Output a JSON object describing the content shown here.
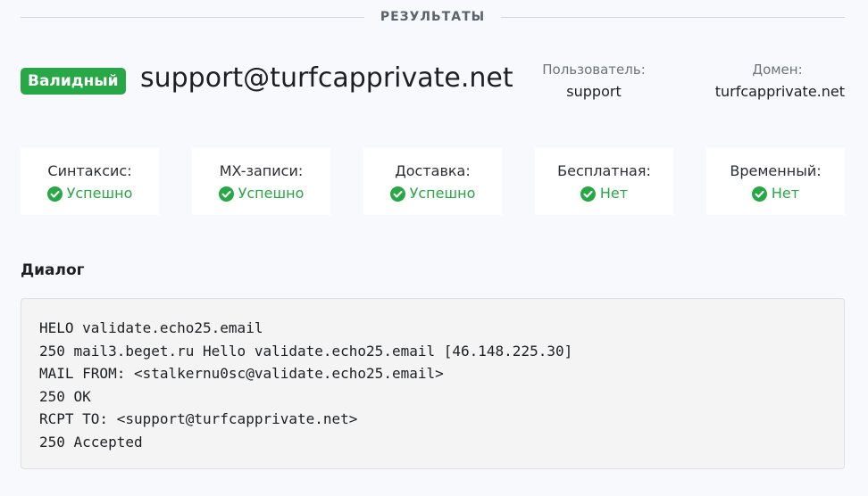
{
  "section": {
    "title": "РЕЗУЛЬТАТЫ"
  },
  "result": {
    "status": "Валидный",
    "status_color": "#27a745",
    "email": "support@turfcapprivate.net",
    "user_label": "Пользователь:",
    "user_value": "support",
    "domain_label": "Домен:",
    "domain_value": "turfcapprivate.net"
  },
  "checks": [
    {
      "label": "Синтаксис:",
      "value": "Успешно",
      "icon": "check-circle-icon"
    },
    {
      "label": "MX-записи:",
      "value": "Успешно",
      "icon": "check-circle-icon"
    },
    {
      "label": "Доставка:",
      "value": "Успешно",
      "icon": "check-circle-icon"
    },
    {
      "label": "Бесплатная:",
      "value": "Нет",
      "icon": "check-circle-icon"
    },
    {
      "label": "Временный:",
      "value": "Нет",
      "icon": "check-circle-icon"
    }
  ],
  "dialog": {
    "title": "Диалог",
    "lines": [
      "HELO validate.echo25.email",
      "250 mail3.beget.ru Hello validate.echo25.email [46.148.225.30]",
      "MAIL FROM: <stalkernu0sc@validate.echo25.email>",
      "250 OK",
      "RCPT TO: <support@turfcapprivate.net>",
      "250 Accepted"
    ]
  }
}
